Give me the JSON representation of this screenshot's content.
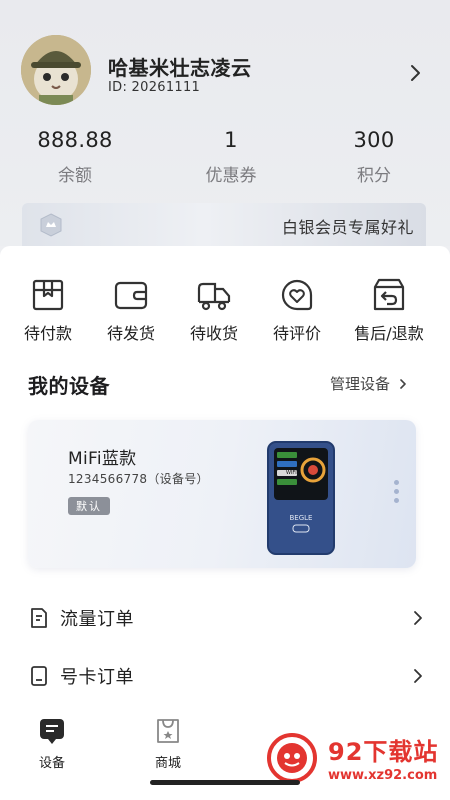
{
  "profile": {
    "username": "哈基米壮志凌云",
    "user_id": "ID: 20261111"
  },
  "stats": [
    {
      "value": "888.88",
      "label": "余额"
    },
    {
      "value": "1",
      "label": "优惠券"
    },
    {
      "value": "300",
      "label": "积分"
    }
  ],
  "banner": {
    "text": "白银会员专属好礼"
  },
  "orders": [
    {
      "label": "待付款",
      "icon": "pending-payment-icon"
    },
    {
      "label": "待发货",
      "icon": "wallet-icon"
    },
    {
      "label": "待收货",
      "icon": "truck-icon"
    },
    {
      "label": "待评价",
      "icon": "heart-review-icon"
    },
    {
      "label": "售后/退款",
      "icon": "return-box-icon"
    }
  ],
  "devices": {
    "title": "我的设备",
    "manage_label": "管理设备",
    "card": {
      "name": "MiFi蓝款",
      "id_text": "1234566778（设备号）",
      "badge": "默认",
      "device_brand": "BEGLE",
      "device_screen_text": "WIFI"
    }
  },
  "menu": [
    {
      "label": "流量订单",
      "icon": "document-icon"
    },
    {
      "label": "号卡订单",
      "icon": "sim-card-icon"
    }
  ],
  "tabbar": [
    {
      "label": "设备",
      "icon": "device-tab-icon",
      "active": true
    },
    {
      "label": "商城",
      "icon": "shop-tab-icon",
      "active": false
    }
  ],
  "watermark": {
    "title": "92下载站",
    "url": "www.xz92.com"
  },
  "colors": {
    "accent": "#e33530",
    "background": "#eeeff2",
    "device_blue": "#34508a"
  }
}
